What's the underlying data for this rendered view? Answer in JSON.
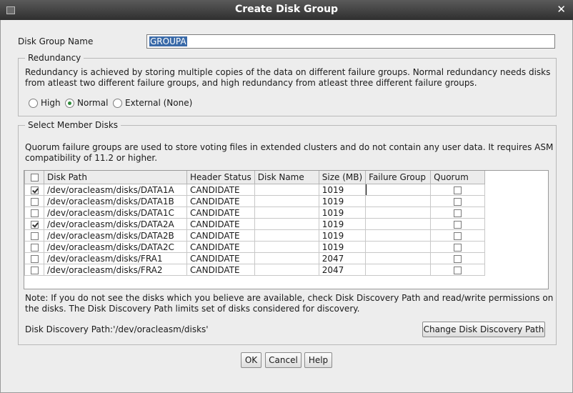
{
  "window": {
    "title": "Create Disk Group"
  },
  "disk_group": {
    "label": "Disk Group Name",
    "value": "GROUPA"
  },
  "redundancy": {
    "legend": "Redundancy",
    "description_line1": "Redundancy is achieved by storing multiple copies of the data on different failure groups. Normal redundancy needs disks",
    "description_line2": "from atleast two different failure groups, and high redundancy from atleast three different failure groups.",
    "options": [
      "High",
      "Normal",
      "External (None)"
    ],
    "selected": "Normal"
  },
  "member_disks": {
    "legend": "Select Member Disks",
    "description_line1": "Quorum failure groups are used to store voting files in extended clusters and do not contain any user data. It requires ASM",
    "description_line2": "compatibility of 11.2 or higher.",
    "columns": [
      "",
      "Disk Path",
      "Header Status",
      "Disk Name",
      "Size (MB)",
      "Failure Group",
      "Quorum"
    ],
    "rows": [
      {
        "checked": true,
        "path": "/dev/oracleasm/disks/DATA1A",
        "status": "CANDIDATE",
        "name": "",
        "size": "1019",
        "failure_group": "",
        "quorum": false
      },
      {
        "checked": false,
        "path": "/dev/oracleasm/disks/DATA1B",
        "status": "CANDIDATE",
        "name": "",
        "size": "1019",
        "failure_group": "",
        "quorum": false
      },
      {
        "checked": false,
        "path": "/dev/oracleasm/disks/DATA1C",
        "status": "CANDIDATE",
        "name": "",
        "size": "1019",
        "failure_group": "",
        "quorum": false
      },
      {
        "checked": true,
        "path": "/dev/oracleasm/disks/DATA2A",
        "status": "CANDIDATE",
        "name": "",
        "size": "1019",
        "failure_group": "",
        "quorum": false
      },
      {
        "checked": false,
        "path": "/dev/oracleasm/disks/DATA2B",
        "status": "CANDIDATE",
        "name": "",
        "size": "1019",
        "failure_group": "",
        "quorum": false
      },
      {
        "checked": false,
        "path": "/dev/oracleasm/disks/DATA2C",
        "status": "CANDIDATE",
        "name": "",
        "size": "1019",
        "failure_group": "",
        "quorum": false
      },
      {
        "checked": false,
        "path": "/dev/oracleasm/disks/FRA1",
        "status": "CANDIDATE",
        "name": "",
        "size": "2047",
        "failure_group": "",
        "quorum": false
      },
      {
        "checked": false,
        "path": "/dev/oracleasm/disks/FRA2",
        "status": "CANDIDATE",
        "name": "",
        "size": "2047",
        "failure_group": "",
        "quorum": false
      }
    ],
    "note_line1": "Note: If you do not see the disks which you believe are available, check Disk Discovery Path and read/write permissions on",
    "note_line2": "the disks. The Disk Discovery Path limits set of disks considered for discovery.",
    "discovery_path": "Disk Discovery Path:'/dev/oracleasm/disks'",
    "change_path_label": "Change Disk Discovery Path"
  },
  "buttons": {
    "ok": "OK",
    "cancel": "Cancel",
    "help": "Help"
  },
  "colors": {
    "selection": "#3a6aa8",
    "radio_dot": "#2e8b3a"
  }
}
